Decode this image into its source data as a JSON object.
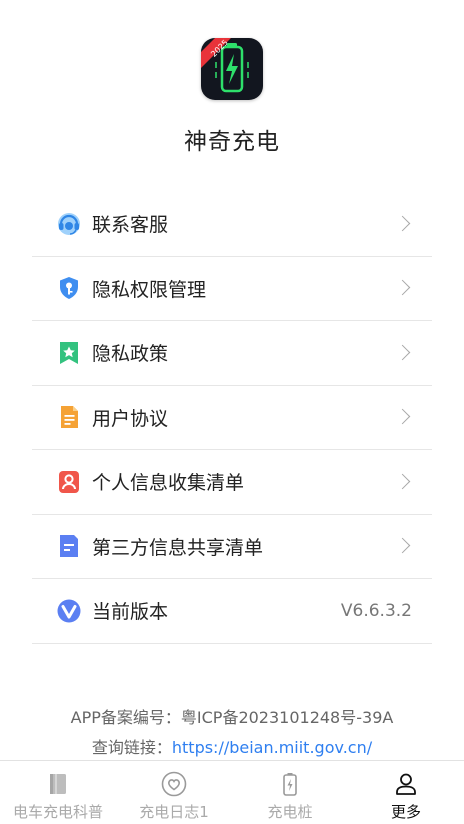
{
  "app": {
    "name": "神奇充电",
    "badge_text": "2025"
  },
  "menu": {
    "items": [
      {
        "label": "联系客服",
        "icon": "headset-icon"
      },
      {
        "label": "隐私权限管理",
        "icon": "shield-key-icon"
      },
      {
        "label": "隐私政策",
        "icon": "bookmark-star-icon"
      },
      {
        "label": "用户协议",
        "icon": "document-icon"
      },
      {
        "label": "个人信息收集清单",
        "icon": "person-icon"
      },
      {
        "label": "第三方信息共享清单",
        "icon": "list-document-icon"
      },
      {
        "label": "当前版本",
        "icon": "version-v-icon",
        "value": "V6.6.3.2"
      }
    ]
  },
  "footer": {
    "icp_label": "APP备案编号：粤ICP备2023101248号-39A",
    "query_label": "查询链接：",
    "query_url": "https://beian.miit.gov.cn/"
  },
  "tabbar": {
    "tabs": [
      {
        "label": "电车充电科普",
        "icon": "book-icon",
        "active": false
      },
      {
        "label": "充电日志1",
        "icon": "heart-icon",
        "active": false
      },
      {
        "label": "充电桩",
        "icon": "battery-bolt-icon",
        "active": false
      },
      {
        "label": "更多",
        "icon": "person-outline-icon",
        "active": true
      }
    ]
  },
  "colors": {
    "accent": "#2f7ff0",
    "icon_bg": "#12161f",
    "battery_green": "#2ee06b",
    "badge_red": "#e8333a"
  }
}
